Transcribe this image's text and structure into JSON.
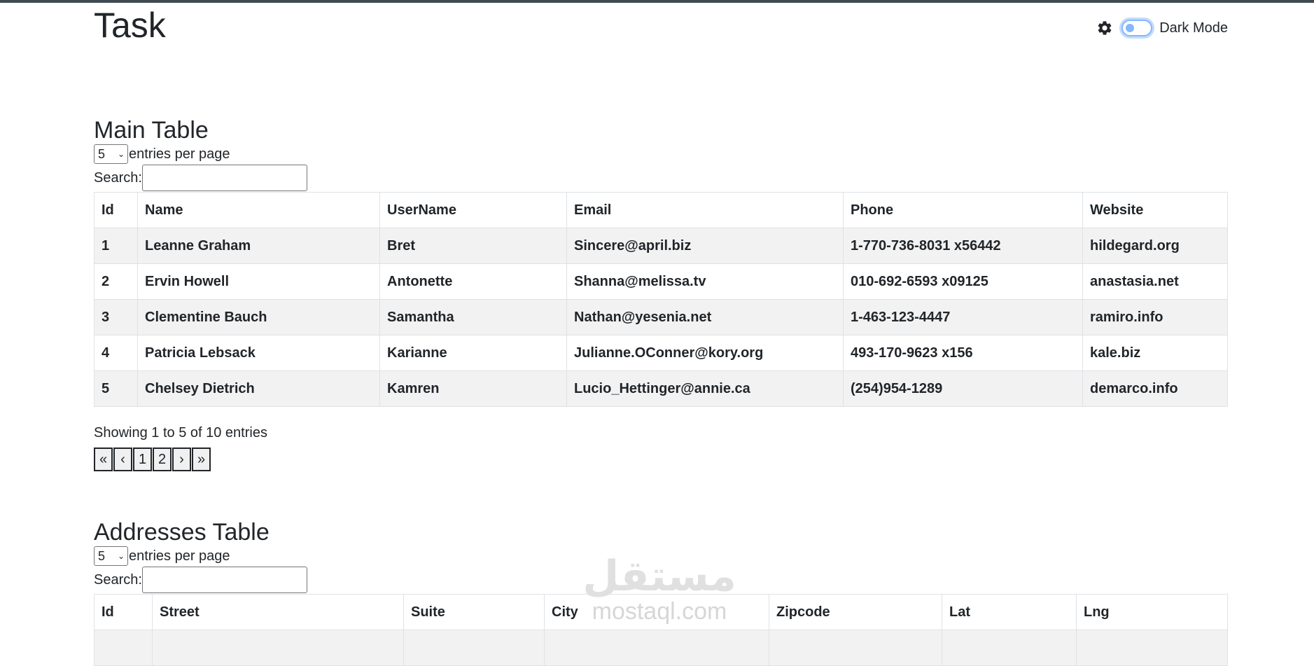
{
  "app": {
    "title": "Task"
  },
  "theme": {
    "toggle_label": "Dark Mode"
  },
  "main_table": {
    "title": "Main Table",
    "entries_value": "5",
    "entries_label": "entries per page",
    "search_label": "Search:",
    "columns": [
      "Id",
      "Name",
      "UserName",
      "Email",
      "Phone",
      "Website"
    ],
    "rows": [
      [
        "1",
        "Leanne Graham",
        "Bret",
        "Sincere@april.biz",
        "1-770-736-8031 x56442",
        "hildegard.org"
      ],
      [
        "2",
        "Ervin Howell",
        "Antonette",
        "Shanna@melissa.tv",
        "010-692-6593 x09125",
        "anastasia.net"
      ],
      [
        "3",
        "Clementine Bauch",
        "Samantha",
        "Nathan@yesenia.net",
        "1-463-123-4447",
        "ramiro.info"
      ],
      [
        "4",
        "Patricia Lebsack",
        "Karianne",
        "Julianne.OConner@kory.org",
        "493-170-9623 x156",
        "kale.biz"
      ],
      [
        "5",
        "Chelsey Dietrich",
        "Kamren",
        "Lucio_Hettinger@annie.ca",
        "(254)954-1289",
        "demarco.info"
      ]
    ],
    "info": "Showing 1 to 5 of 10 entries",
    "pager": [
      "«",
      "‹",
      "1",
      "2",
      "›",
      "»"
    ]
  },
  "addresses_table": {
    "title": "Addresses Table",
    "entries_value": "5",
    "entries_label": "entries per page",
    "search_label": "Search:",
    "columns": [
      "Id",
      "Street",
      "Suite",
      "City",
      "Zipcode",
      "Lat",
      "Lng"
    ]
  },
  "watermark": {
    "arabic": "مستقل",
    "latin": "mostaql.com"
  }
}
